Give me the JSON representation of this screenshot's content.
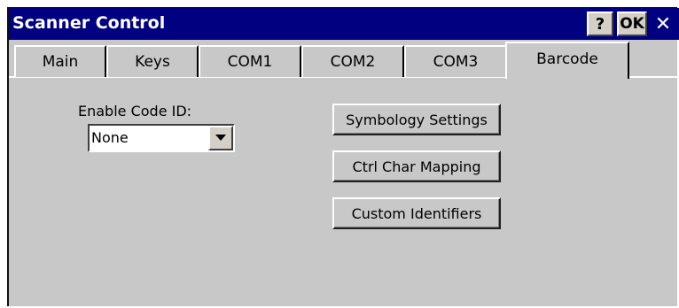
{
  "window": {
    "title": "Scanner Control",
    "help_label": "?",
    "ok_label": "OK",
    "close_label": "✕"
  },
  "tabs": [
    {
      "label": "Main",
      "active": false
    },
    {
      "label": "Keys",
      "active": false
    },
    {
      "label": "COM1",
      "active": false
    },
    {
      "label": "COM2",
      "active": false
    },
    {
      "label": "COM3",
      "active": false
    },
    {
      "label": "Barcode",
      "active": true
    }
  ],
  "barcode_page": {
    "code_id_label": "Enable Code ID:",
    "code_id_value": "None",
    "buttons": [
      {
        "label": "Symbology Settings"
      },
      {
        "label": "Ctrl Char Mapping"
      },
      {
        "label": "Custom Identifiers"
      }
    ]
  },
  "colors": {
    "titlebar": "#000080",
    "face": "#c8c8c8"
  }
}
